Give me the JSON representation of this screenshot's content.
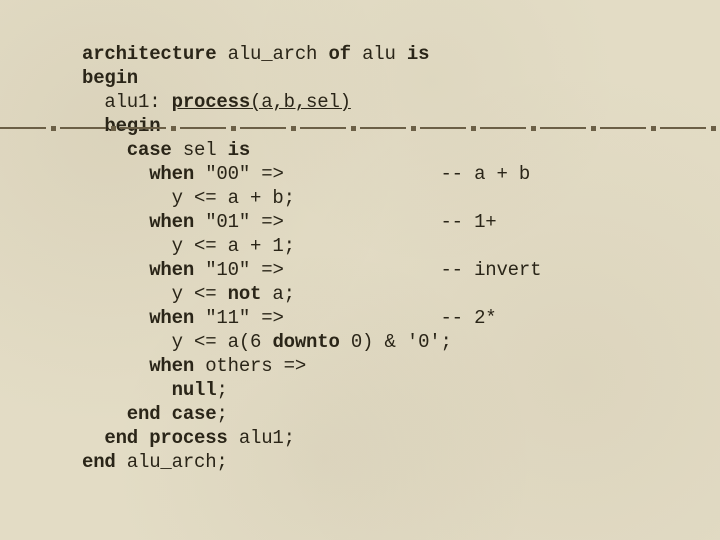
{
  "code": {
    "l1a": "architecture",
    "l1b": " alu_arch ",
    "l1c": "of",
    "l1d": " alu ",
    "l1e": "is",
    "l2a": "begin",
    "l3a": "  alu1: ",
    "l3b": "process",
    "l3c": "(a,b,sel)",
    "l4a": "  begin",
    "l5a": "    case",
    "l5b": " sel ",
    "l5c": "is",
    "l6a": "      when",
    "l6b": " \"00\" =>              -- a + b",
    "l7a": "        y <= a + b;",
    "l8a": "      when",
    "l8b": " \"01\" =>              -- 1+",
    "l9a": "        y <= a + 1;",
    "l10a": "      when",
    "l10b": " \"10\" =>              -- invert",
    "l11a": "        y <= ",
    "l11b": "not",
    "l11c": " a;",
    "l12a": "      when",
    "l12b": " \"11\" =>              -- 2*",
    "l13a": "        y <= a(6 ",
    "l13b": "downto",
    "l13c": " 0) & '0';",
    "l14a": "      when",
    "l14b": " others =>",
    "l15a": "        null",
    "l15b": ";",
    "l16a": "    end case",
    "l16b": ";",
    "l17a": "  end process",
    "l17b": " alu1;",
    "l18a": "end",
    "l18b": " alu_arch;"
  }
}
